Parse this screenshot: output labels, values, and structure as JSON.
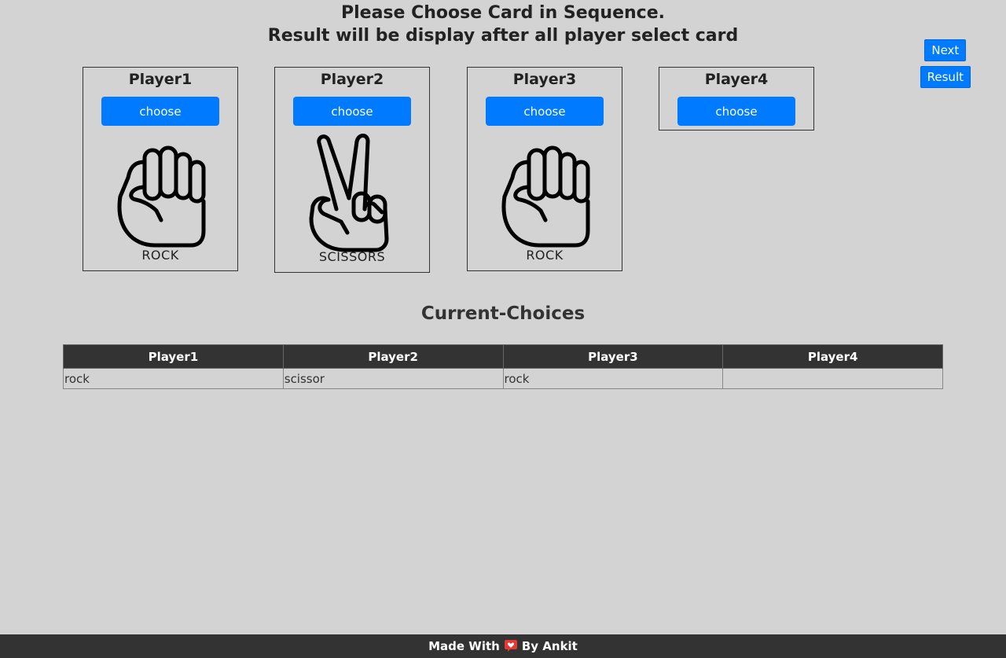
{
  "heading": {
    "line1": "Please Choose Card in Sequence.",
    "line2": "Result will be display after all player select card"
  },
  "side_buttons": {
    "next": "Next",
    "result": "Result"
  },
  "players": [
    {
      "name": "Player1",
      "button": "choose",
      "card": "ROCK",
      "icon": "rock-hand-icon"
    },
    {
      "name": "Player2",
      "button": "choose",
      "card": "SCISSORS",
      "icon": "scissors-hand-icon"
    },
    {
      "name": "Player3",
      "button": "choose",
      "card": "ROCK",
      "icon": "rock-hand-icon"
    },
    {
      "name": "Player4",
      "button": "choose",
      "card": "",
      "icon": ""
    }
  ],
  "current_choices": {
    "title": "Current-Choices",
    "headers": [
      "Player1",
      "Player2",
      "Player3",
      "Player4"
    ],
    "rows": [
      [
        "rock",
        "scissor",
        "rock",
        ""
      ]
    ]
  },
  "footer": {
    "before": "Made With",
    "after": "By Ankit",
    "icon": "heart-icon"
  },
  "colors": {
    "accent": "#007bff",
    "background": "#d3d3d3",
    "dark": "#333333"
  }
}
